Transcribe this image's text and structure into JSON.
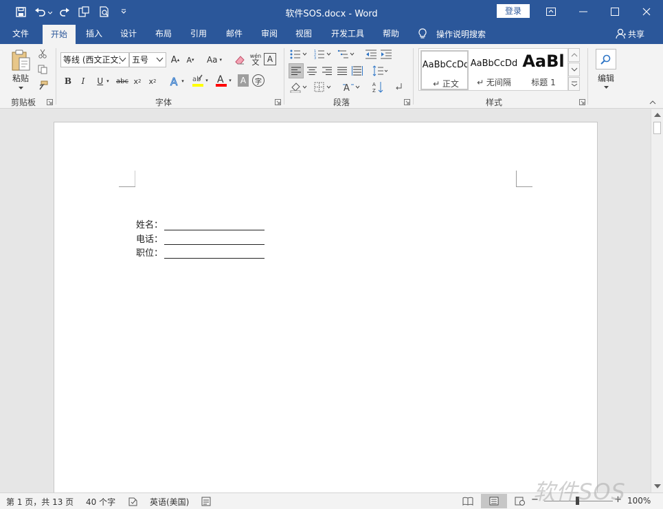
{
  "window": {
    "title": "软件SOS.docx  -  Word",
    "login_label": "登录"
  },
  "quick_access": [
    "save-icon",
    "undo-icon",
    "redo-icon",
    "touch-mode-icon",
    "print-preview-icon",
    "customize-qat-icon"
  ],
  "tabs": [
    "文件",
    "开始",
    "插入",
    "设计",
    "布局",
    "引用",
    "邮件",
    "审阅",
    "视图",
    "开发工具",
    "帮助"
  ],
  "tell_me": "操作说明搜索",
  "share": "共享",
  "ribbon": {
    "clipboard": {
      "paste_label": "粘贴",
      "group_label": "剪贴板"
    },
    "font": {
      "font_name": "等线 (西文正文)",
      "font_size": "五号",
      "group_label": "字体"
    },
    "paragraph": {
      "group_label": "段落"
    },
    "styles": {
      "group_label": "样式",
      "items": [
        {
          "sample": "AaBbCcDd",
          "name": "↵ 正文"
        },
        {
          "sample": "AaBbCcDd",
          "name": "↵ 无间隔"
        },
        {
          "sample": "AaBl",
          "name": "标题 1"
        }
      ]
    },
    "editing": {
      "label": "编辑"
    }
  },
  "document": {
    "fields": [
      {
        "label": "姓名："
      },
      {
        "label": "电话："
      },
      {
        "label": "职位："
      }
    ]
  },
  "status": {
    "page": "第 1 页，共 13 页",
    "words": "40 个字",
    "language": "英语(美国)",
    "zoom": "100%",
    "zoom_level": 1.0
  },
  "watermark": "软件SOS",
  "colors": {
    "title_bar": "#2b579a",
    "highlight": "#ffff00",
    "font_color": "#ff0000"
  }
}
